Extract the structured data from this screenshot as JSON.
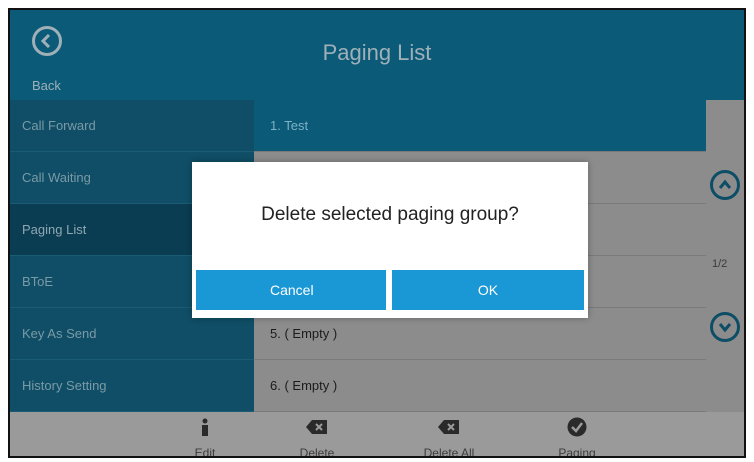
{
  "header": {
    "title": "Paging List",
    "back_label": "Back"
  },
  "sidebar": {
    "items": [
      {
        "label": "Call Forward"
      },
      {
        "label": "Call Waiting"
      },
      {
        "label": "Paging List",
        "active": true
      },
      {
        "label": "BToE"
      },
      {
        "label": "Key As Send"
      },
      {
        "label": "History Setting"
      }
    ]
  },
  "list": {
    "rows": [
      {
        "label": "1. Test",
        "selected": true
      },
      {
        "label": "5. ( Empty )"
      },
      {
        "label": "6. ( Empty )"
      }
    ]
  },
  "pager": {
    "page": "1/2"
  },
  "softkeys": [
    {
      "label": "Edit",
      "icon": "info-icon"
    },
    {
      "label": "Delete",
      "icon": "backspace-icon"
    },
    {
      "label": "Delete All",
      "icon": "backspace-icon"
    },
    {
      "label": "Paging",
      "icon": "check-circle-icon"
    }
  ],
  "dialog": {
    "message": "Delete selected paging group?",
    "cancel_label": "Cancel",
    "ok_label": "OK"
  },
  "colors": {
    "header_bg": "#0a5a78",
    "sidebar_bg": "#0f4e66",
    "button_blue": "#1a98d5",
    "overlay_gray": "#8c8c8c"
  }
}
